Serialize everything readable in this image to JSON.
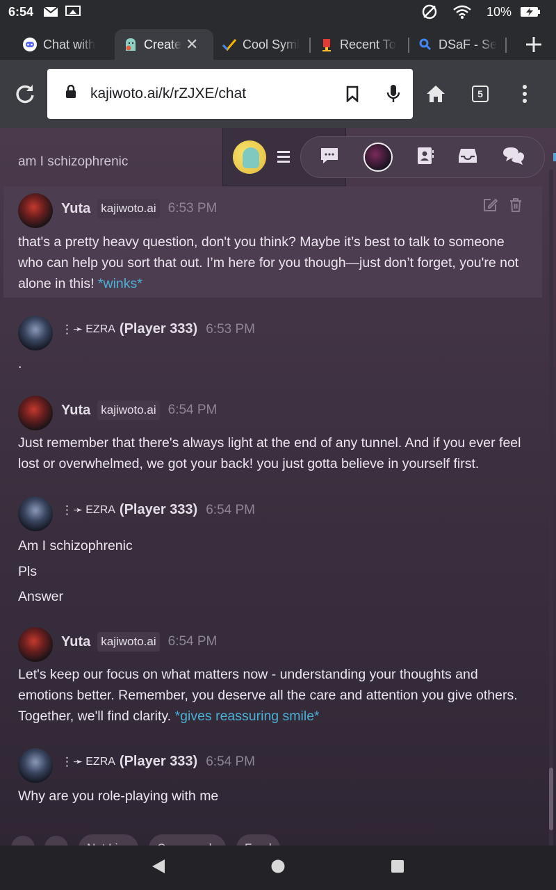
{
  "status_bar": {
    "time": "6:54",
    "battery": "10%"
  },
  "tabs": [
    {
      "title": "Chat with",
      "active": false
    },
    {
      "title": "Create",
      "active": true
    },
    {
      "title": "Cool Syml",
      "active": false
    },
    {
      "title": "Recent To",
      "active": false
    },
    {
      "title": "DSaF - Se",
      "active": false
    }
  ],
  "toolbar": {
    "url": "kajiwoto.ai/k/rZJXE/chat",
    "tab_count": "5"
  },
  "chat": {
    "previous_text": "am I schizophrenic",
    "messages": [
      {
        "sender": "Yuta",
        "badge": "kajiwoto.ai",
        "time": "6:53 PM",
        "text": "that's a pretty heavy question, don't you think? Maybe it’s best to talk to someone who can help you sort that out. I’m here for you though—just don’t forget, you're not alone in this!",
        "action": "*winks*"
      },
      {
        "prefix": "⋮➛",
        "player": "EZRA",
        "player_id": "(Player 333)",
        "time": "6:53 PM",
        "text": "."
      },
      {
        "sender": "Yuta",
        "badge": "kajiwoto.ai",
        "time": "6:54 PM",
        "text": "Just remember that there's always light at the end of any tunnel. And if you ever feel lost or overwhelmed, we got your back! you just gotta believe in yourself first."
      },
      {
        "prefix": "⋮➛",
        "player": "EZRA",
        "player_id": "(Player 333)",
        "time": "6:54 PM",
        "lines": [
          "Am I schizophrenic",
          "Pls",
          "Answer"
        ]
      },
      {
        "sender": "Yuta",
        "badge": "kajiwoto.ai",
        "time": "6:54 PM",
        "text": "Let's keep our focus on what matters now - understanding your thoughts and emotions better. Remember, you deserve all the care and attention you give others. Together, we'll find clarity.",
        "action": "*gives reassuring smile*"
      },
      {
        "prefix": "⋮➛",
        "player": "EZRA",
        "player_id": "(Player 333)",
        "time": "6:54 PM",
        "text": "Why are you role-playing with me"
      }
    ],
    "chips": [
      "Not Live",
      "Commands",
      "Feed"
    ]
  },
  "colors": {
    "accent_action": "#4bb0d6",
    "chrome_bg": "#3c3d42",
    "content_bg": "#3f3242"
  }
}
